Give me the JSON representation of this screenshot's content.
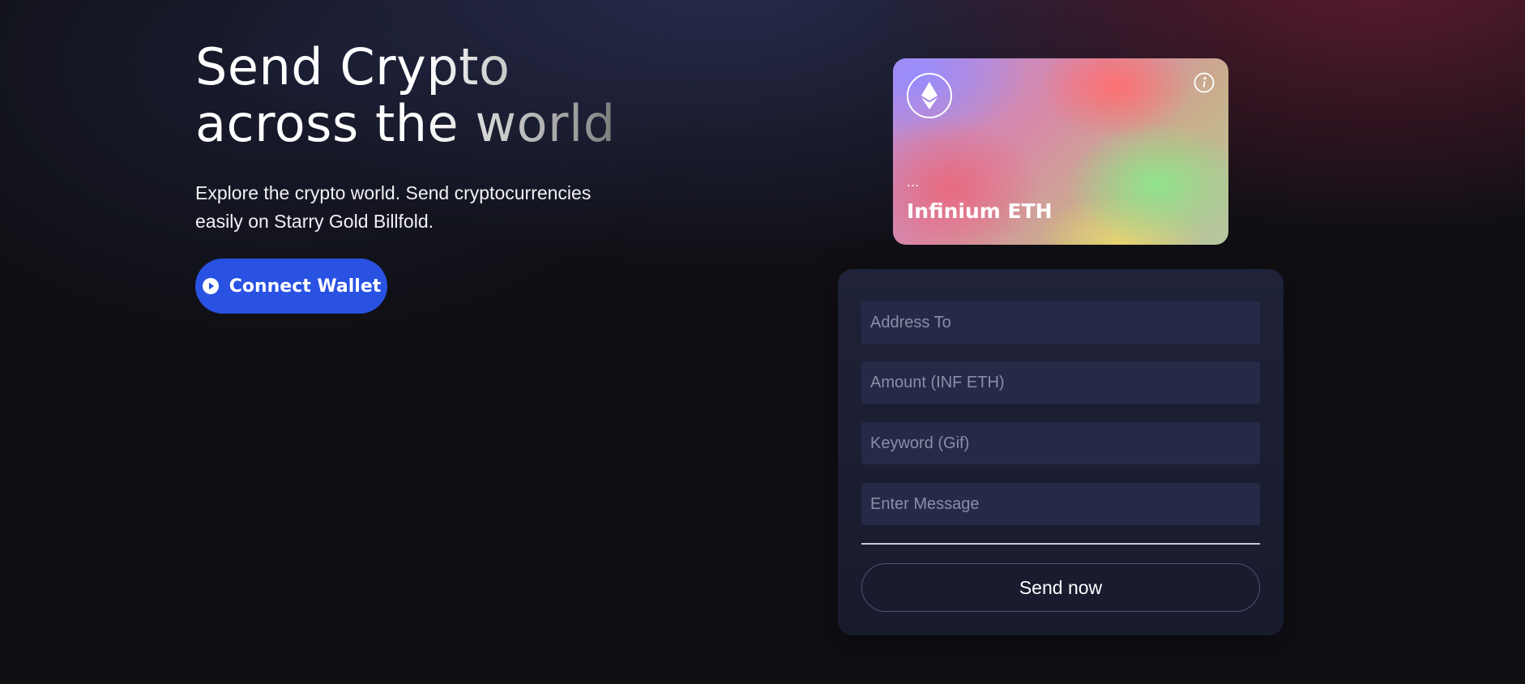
{
  "hero": {
    "title_line1": "Send Crypto",
    "title_line2": "across the world",
    "subtitle": "Explore the crypto world. Send cryptocurrencies easily on Starry Gold Billfold.",
    "connect_button_label": "Connect Wallet",
    "connect_button_icon": "play-circle-icon"
  },
  "card": {
    "logo_icon": "ethereum-icon",
    "info_icon": "info-icon",
    "address": "...",
    "name": "Infinium ETH"
  },
  "form": {
    "address_placeholder": "Address To",
    "amount_placeholder": "Amount (INF ETH)",
    "keyword_placeholder": "Keyword (Gif)",
    "message_placeholder": "Enter Message",
    "send_label": "Send now"
  },
  "colors": {
    "background": "#0f0f14",
    "accent_blue": "#2952e3",
    "form_panel": "#1f2238",
    "input_fill": "#252a47"
  }
}
